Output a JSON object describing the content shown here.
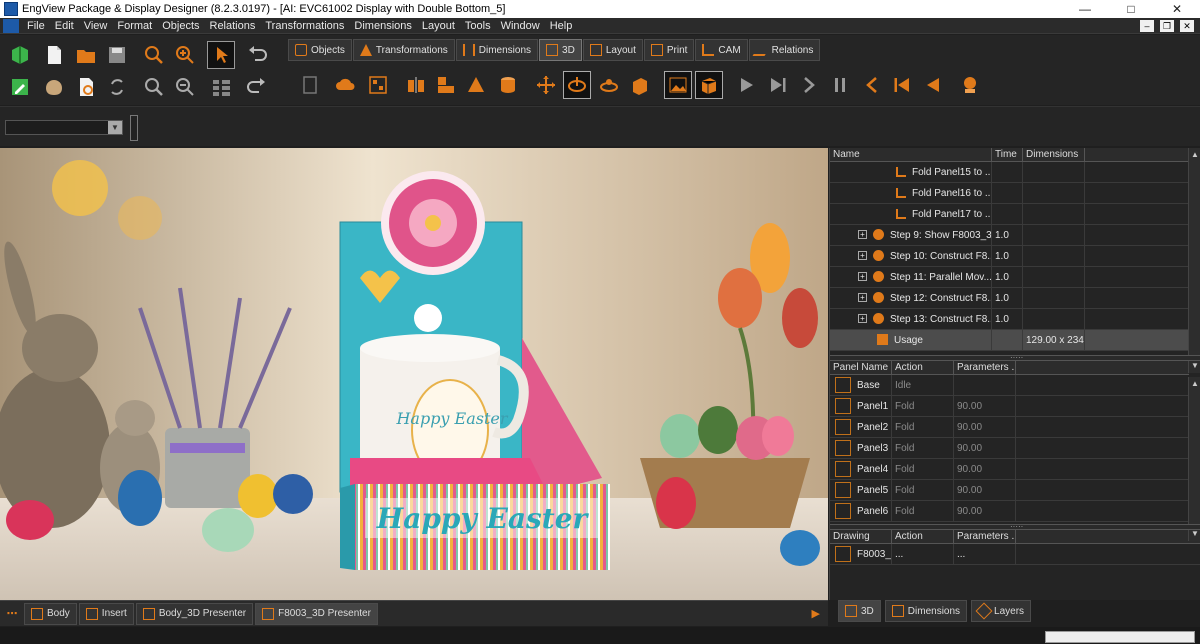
{
  "window": {
    "title": "EngView Package & Display Designer (8.2.3.0197) - [AI: EVC61002 Display with Double Bottom_5]"
  },
  "menu": [
    "File",
    "Edit",
    "View",
    "Format",
    "Objects",
    "Relations",
    "Transformations",
    "Dimensions",
    "Layout",
    "Tools",
    "Window",
    "Help"
  ],
  "tabs": [
    "Objects",
    "Transformations",
    "Dimensions",
    "3D",
    "Layout",
    "Print",
    "CAM",
    "Relations"
  ],
  "status_tabs": [
    "Body",
    "Insert",
    "Body_3D Presenter",
    "F8003_3D Presenter"
  ],
  "steps_table": {
    "headers": [
      "Name",
      "Time",
      "Dimensions"
    ],
    "rows": [
      {
        "name": "Fold Panel15 to ...",
        "time": "",
        "dims": "",
        "kind": "fold"
      },
      {
        "name": "Fold Panel16 to ...",
        "time": "",
        "dims": "",
        "kind": "fold"
      },
      {
        "name": "Fold Panel17 to ...",
        "time": "",
        "dims": "",
        "kind": "fold"
      },
      {
        "name": "Step 9: Show F8003_3...",
        "time": "1.0",
        "dims": "",
        "kind": "step"
      },
      {
        "name": "Step 10: Construct F8...",
        "time": "1.0",
        "dims": "",
        "kind": "step"
      },
      {
        "name": "Step 11: Parallel Mov...",
        "time": "1.0",
        "dims": "",
        "kind": "step"
      },
      {
        "name": "Step 12: Construct F8...",
        "time": "1.0",
        "dims": "",
        "kind": "step"
      },
      {
        "name": "Step 13: Construct F8...",
        "time": "1.0",
        "dims": "",
        "kind": "step"
      },
      {
        "name": "Usage",
        "time": "",
        "dims": "129.00 x 234....",
        "kind": "usage"
      }
    ]
  },
  "panels_table": {
    "headers": [
      "Panel Name",
      "Action",
      "Parameters ..."
    ],
    "rows": [
      {
        "name": "Base",
        "action": "Idle",
        "param": ""
      },
      {
        "name": "Panel1",
        "action": "Fold",
        "param": "90.00"
      },
      {
        "name": "Panel2",
        "action": "Fold",
        "param": "90.00"
      },
      {
        "name": "Panel3",
        "action": "Fold",
        "param": "90.00"
      },
      {
        "name": "Panel4",
        "action": "Fold",
        "param": "90.00"
      },
      {
        "name": "Panel5",
        "action": "Fold",
        "param": "90.00"
      },
      {
        "name": "Panel6",
        "action": "Fold",
        "param": "90.00"
      }
    ]
  },
  "drawing_table": {
    "headers": [
      "Drawing",
      "Action",
      "Parameters ..."
    ],
    "rows": [
      {
        "name": "F8003_...",
        "action": "...",
        "param": "..."
      }
    ]
  },
  "right_tabs": [
    "3D",
    "Dimensions",
    "Layers"
  ],
  "scene_text": {
    "mug": "Happy Easter",
    "banner": "Happy Easter"
  }
}
